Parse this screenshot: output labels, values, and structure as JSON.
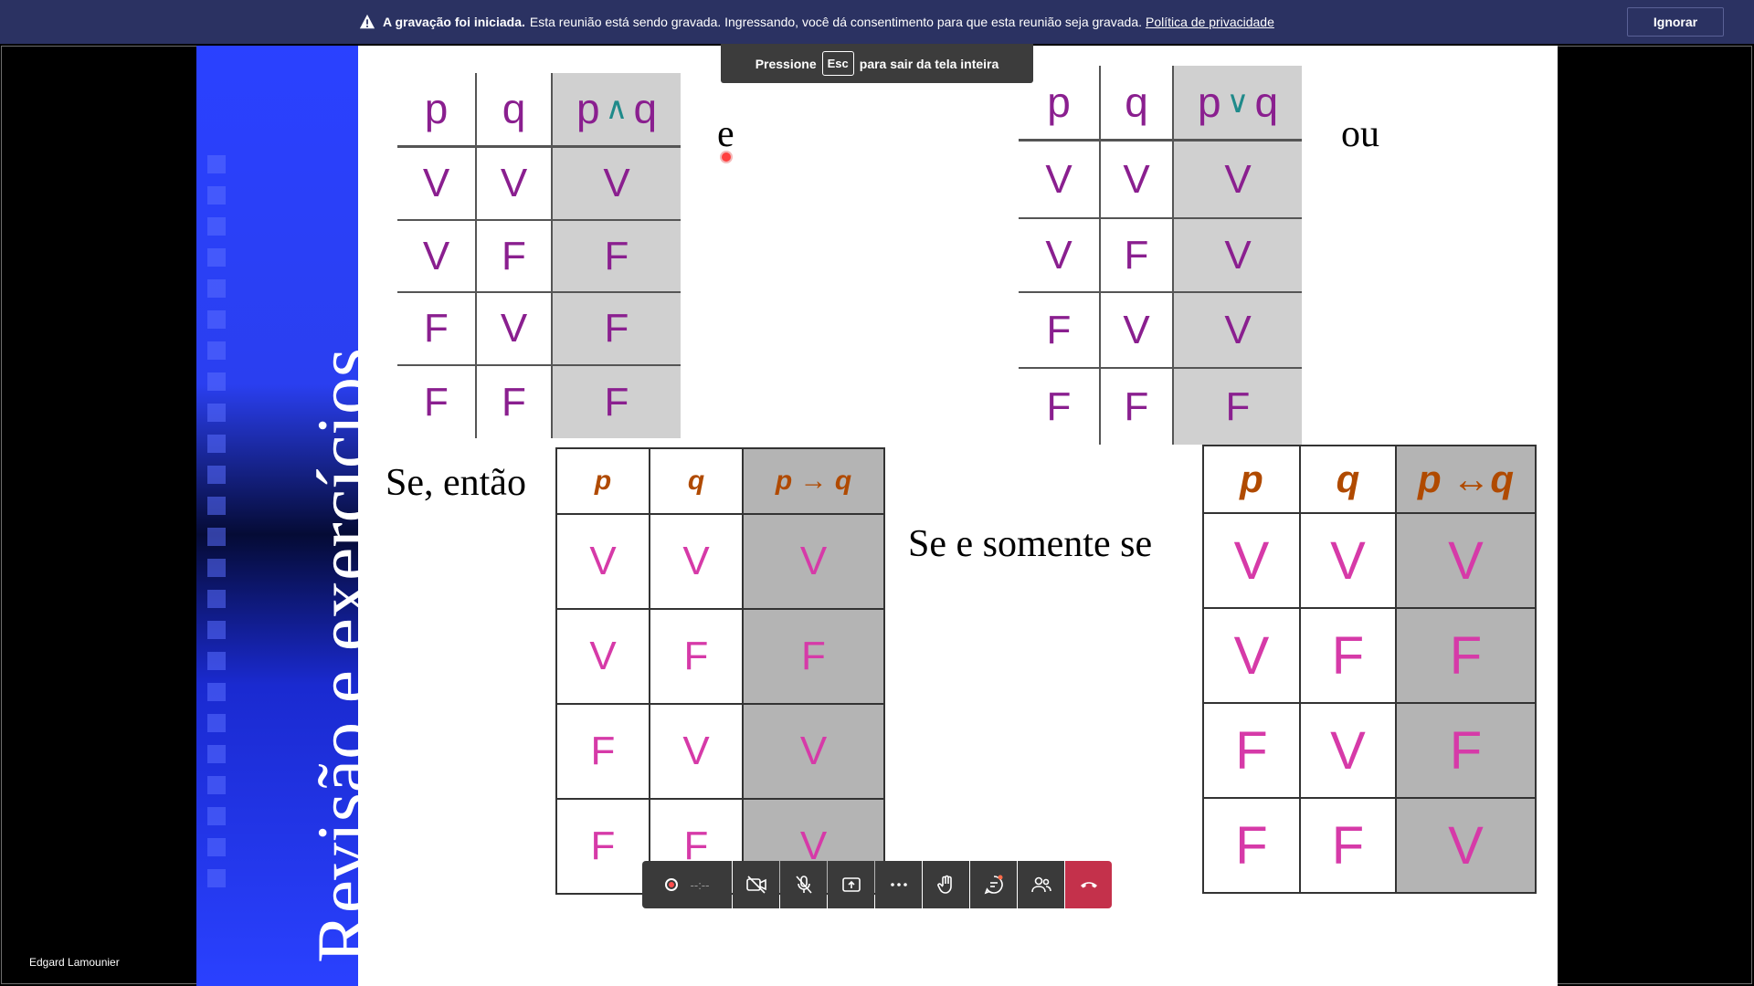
{
  "banner": {
    "bold": "A gravação foi iniciada.",
    "text": "Esta reunião está sendo gravada. Ingressando, você dá consentimento para que esta reunião seja gravada.",
    "link": "Política de privacidade",
    "ignore": "Ignorar"
  },
  "esc_hint": {
    "before": "Pressione",
    "key": "Esc",
    "after": "para sair da tela inteira"
  },
  "slide": {
    "side_title": "Revisão e exercícios",
    "and_word": "e",
    "or_word": "ou",
    "if_word": "Se, então",
    "iff_word": "Se e somente se",
    "and_table": {
      "headers": [
        "p",
        "q",
        "p",
        "∧",
        "q"
      ],
      "rows": [
        [
          "V",
          "V",
          "V"
        ],
        [
          "V",
          "F",
          "F"
        ],
        [
          "F",
          "V",
          "F"
        ],
        [
          "F",
          "F",
          "F"
        ]
      ]
    },
    "or_table": {
      "headers": [
        "p",
        "q",
        "p",
        "∨",
        "q"
      ],
      "rows": [
        [
          "V",
          "V",
          "V"
        ],
        [
          "V",
          "F",
          "V"
        ],
        [
          "F",
          "V",
          "V"
        ],
        [
          "F",
          "F",
          "F"
        ]
      ]
    },
    "if_table": {
      "headers": [
        "p",
        "q",
        "p → q"
      ],
      "rows": [
        [
          "V",
          "V",
          "V"
        ],
        [
          "V",
          "F",
          "F"
        ],
        [
          "F",
          "V",
          "V"
        ],
        [
          "F",
          "F",
          "V"
        ]
      ]
    },
    "iff_table": {
      "headers": [
        "p",
        "q",
        "p ↔q"
      ],
      "rows": [
        [
          "V",
          "V",
          "V"
        ],
        [
          "V",
          "F",
          "F"
        ],
        [
          "F",
          "V",
          "F"
        ],
        [
          "F",
          "F",
          "V"
        ]
      ]
    }
  },
  "controls": {
    "rec_time": "--:--"
  },
  "participant": {
    "name": "Edgard Lamounier"
  }
}
